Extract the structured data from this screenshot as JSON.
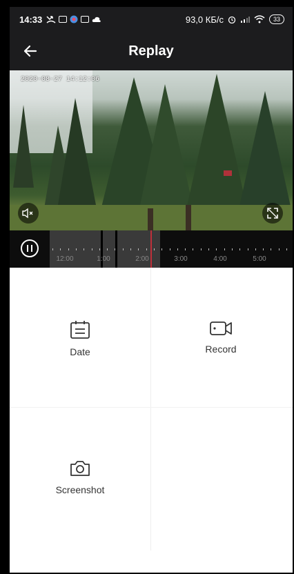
{
  "status_bar": {
    "time": "14:33",
    "network_speed": "93,0 КБ/с",
    "battery": "33",
    "icons": [
      "missed-call-icon",
      "mail-icon",
      "app-icon",
      "mail-icon",
      "cloud-icon",
      "alarm-icon",
      "signal-icon",
      "wifi-icon",
      "battery-icon"
    ]
  },
  "app_bar": {
    "title": "Replay",
    "back_icon": "back-arrow-icon"
  },
  "video": {
    "timestamp": "2020-08-27 14:12:06"
  },
  "timeline": {
    "labels": [
      "12:00",
      "1:00",
      "2:00",
      "3:00",
      "4:00",
      "5:00"
    ],
    "playhead_color": "#c0303a"
  },
  "actions": {
    "date_label": "Date",
    "record_label": "Record",
    "screenshot_label": "Screenshot"
  }
}
